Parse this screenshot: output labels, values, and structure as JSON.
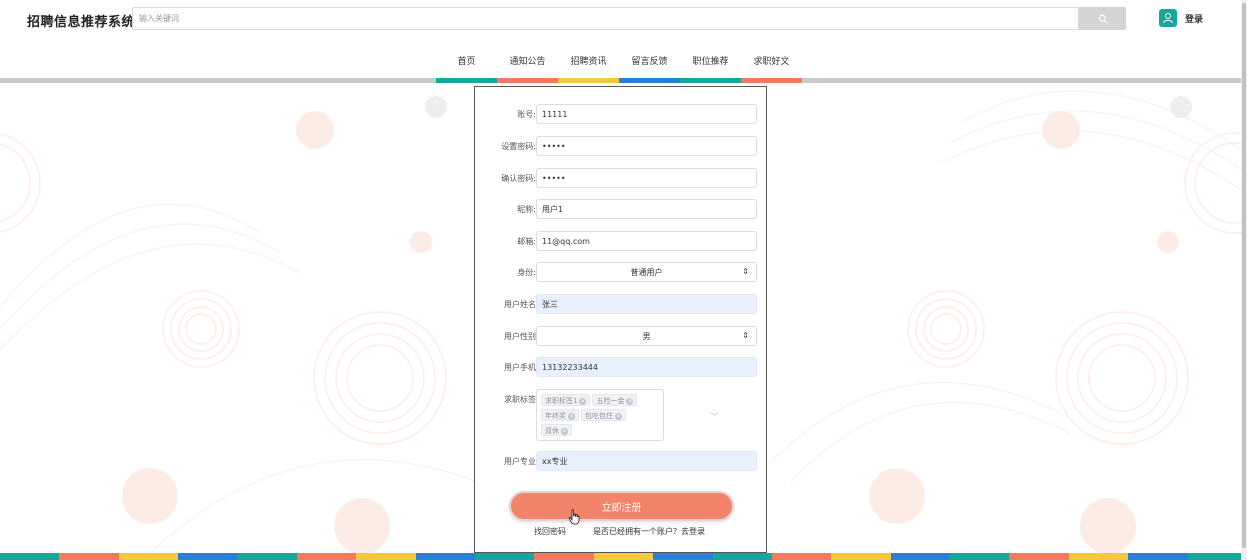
{
  "header": {
    "site_title": "招聘信息推荐系统",
    "search_placeholder": "输入关键词",
    "search_icon": "search-icon",
    "user_icon": "user-icon",
    "login_label": "登录"
  },
  "nav": {
    "items": [
      {
        "label": "首页",
        "color": "#1aa59a"
      },
      {
        "label": "通知公告",
        "color": "#f07c60"
      },
      {
        "label": "招聘资讯",
        "color": "#f5c842"
      },
      {
        "label": "留言反馈",
        "color": "#2d7fd3"
      },
      {
        "label": "职位推荐",
        "color": "#1aa59a"
      },
      {
        "label": "求职好文",
        "color": "#f07c60"
      }
    ]
  },
  "form": {
    "account": {
      "label": "账号:",
      "value": "11111"
    },
    "password": {
      "label": "设置密码:",
      "value": "•••••"
    },
    "confirm_password": {
      "label": "确认密码:",
      "value": "•••••"
    },
    "nickname": {
      "label": "昵称:",
      "value": "用户1"
    },
    "email": {
      "label": "邮箱:",
      "value": "11@qq.com"
    },
    "role": {
      "label": "身份:",
      "value": "普通用户"
    },
    "real_name": {
      "label": "用户姓名",
      "value": "张三"
    },
    "gender": {
      "label": "用户性别",
      "value": "男"
    },
    "phone": {
      "label": "用户手机",
      "value": "13132233444"
    },
    "job_tags": {
      "label": "求职标签",
      "tags": [
        "求职标签1",
        "五险一金",
        "年终奖",
        "包吃包住",
        "双休"
      ]
    },
    "major": {
      "label": "用户专业",
      "value": "xx专业"
    },
    "submit_label": "立即注册",
    "forgot_label": "找回密码",
    "have_account_label": "是否已经拥有一个账户？去登录"
  },
  "colors": {
    "accent_teal": "#1aa59a",
    "accent_coral": "#f07c60",
    "accent_yellow": "#f5c842",
    "accent_blue": "#2d7fd3",
    "submit_button": "#f4836b"
  }
}
